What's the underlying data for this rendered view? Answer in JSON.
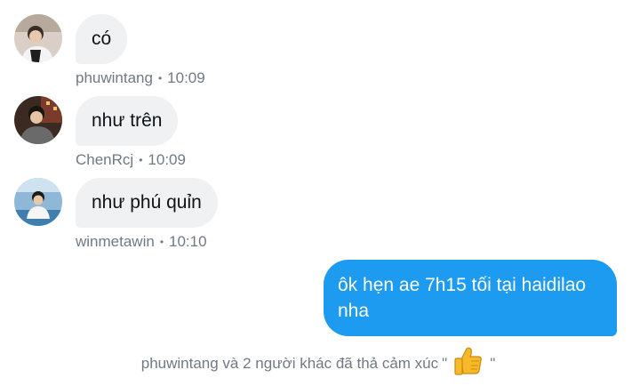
{
  "messages": [
    {
      "text": "có",
      "author": "phuwintang",
      "time": "10:09",
      "avatar_icon": "user-avatar-icon"
    },
    {
      "text": "như trên",
      "author": "ChenRcj",
      "time": "10:09",
      "avatar_icon": "user-avatar-icon"
    },
    {
      "text": "như phú quỉn",
      "author": "winmetawin",
      "time": "10:10",
      "avatar_icon": "user-avatar-icon"
    }
  ],
  "outgoing": {
    "text": "ôk hẹn ae 7h15 tối tại haidilao nha"
  },
  "reaction": {
    "text": "phuwintang và 2 người khác đã thả cảm xúc",
    "quote_open": "\"",
    "quote_close": "\"",
    "emoji_icon": "thumbs-up-icon"
  },
  "colors": {
    "incoming_bubble": "#eff1f3",
    "outgoing_bubble": "#1d9bf0",
    "meta_text": "#6f7a84"
  },
  "separator": "•"
}
